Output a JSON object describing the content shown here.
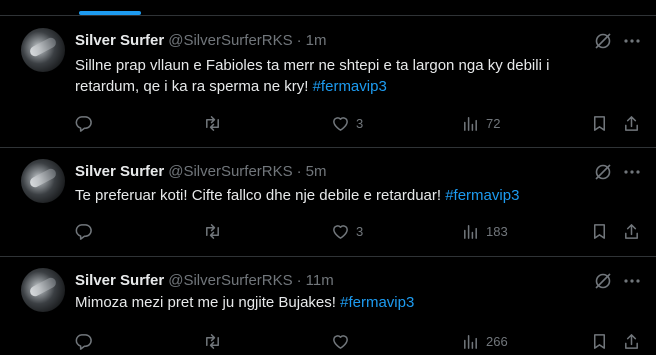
{
  "tweets": [
    {
      "name": "Silver Surfer",
      "handle": "@SilverSurferRKS",
      "sep": "·",
      "time": "1m",
      "text_lines": [
        "Sillne prap vllaun e Fabioles ta merr ne shtepi e ta largon nga ky debili i",
        "retardum, qe i ka ra sperma ne kry! "
      ],
      "hashtag": "#fermavip3",
      "likes": "3",
      "views": "72"
    },
    {
      "name": "Silver Surfer",
      "handle": "@SilverSurferRKS",
      "sep": "·",
      "time": "5m",
      "text": "Te preferuar koti! Cifte fallco dhe nje debile e retarduar! ",
      "hashtag": "#fermavip3",
      "likes": "3",
      "views": "183"
    },
    {
      "name": "Silver Surfer",
      "handle": "@SilverSurferRKS",
      "sep": "·",
      "time": "11m",
      "text": "Mimoza mezi pret me ju ngjite Bujakes! ",
      "hashtag": "#fermavip3",
      "likes": "",
      "views": "266"
    }
  ],
  "icons": {
    "reply": "reply-icon",
    "retweet": "retweet-icon",
    "like": "heart-icon",
    "views": "views-icon",
    "bookmark": "bookmark-icon",
    "share": "share-icon",
    "grok": "grok-icon",
    "more": "more-icon"
  },
  "colors": {
    "background": "#000000",
    "text": "#e7e9ea",
    "muted": "#71767b",
    "accent": "#1d9bf0",
    "divider": "#2f3336"
  }
}
